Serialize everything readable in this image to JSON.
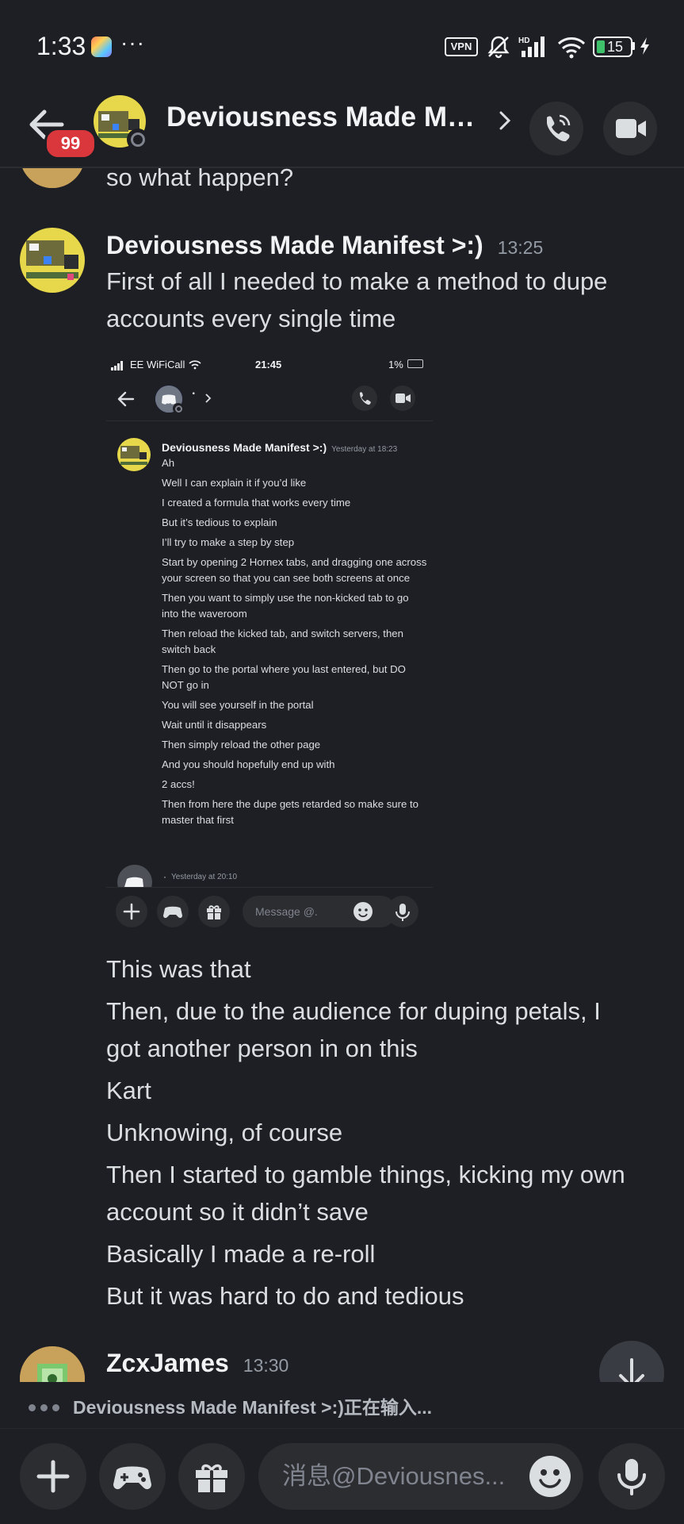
{
  "status_bar": {
    "time": "1:33",
    "more": "···",
    "vpn_label": "VPN",
    "battery": "15",
    "hd_label": "HD"
  },
  "header": {
    "unread_count": "99",
    "title": "Deviousness Made Manifest >:)"
  },
  "messages": {
    "prev_fragment": "so what happen?",
    "main_author": "Deviousness Made Manifest >:)",
    "main_time": "13:25",
    "main_text_1": "First of all I needed to make a method to dupe",
    "main_text_2": "accounts every single time",
    "followups": [
      "This was that",
      "Then, due to the audience for duping petals, I",
      "got another person in on this",
      "Kart",
      "Unknowing, of course",
      "Then I started to gamble things, kicking my own",
      "account so it didn’t save",
      "Basically I made a re-roll",
      "But it was hard to do and tedious"
    ],
    "next_author": "ZcxJames",
    "next_time": "13:30"
  },
  "embed": {
    "status_left": "EE WiFiCall",
    "clock": "21:45",
    "battery": "1%",
    "title": "·",
    "author": "Deviousness Made Manifest >:)",
    "time": "Yesterday at 18:23",
    "lines": [
      "Ah",
      "Well I can explain it if you’d like",
      "I created a formula that works every time",
      "But it’s tedious to explain",
      "I’ll try to make a step by step",
      "Start by opening 2 Hornex tabs, and dragging one across your screen so that you can see both screens at once",
      "Then you want to simply use the non-kicked tab to go into the waveroom",
      "Then reload the kicked tab, and switch servers, then switch back",
      "Then go to the portal where you last entered, but DO NOT go in",
      "You will see yourself in the portal",
      "Wait until it disappears",
      "Then simply reload the other page",
      "And you should hopefully end up with",
      "2 accs!",
      "Then from here the dupe gets retarded so make sure to master that first"
    ],
    "next_name": "·",
    "next_time": "Yesterday at 20:10",
    "input_placeholder": "Message @."
  },
  "typing": {
    "text": "Deviousness Made Manifest >:)正在输入..."
  },
  "composer": {
    "placeholder": "消息@Deviousnes..."
  },
  "colors": {
    "background": "#1e1f24",
    "badge": "#da373c",
    "battery": "#3ec16a"
  }
}
